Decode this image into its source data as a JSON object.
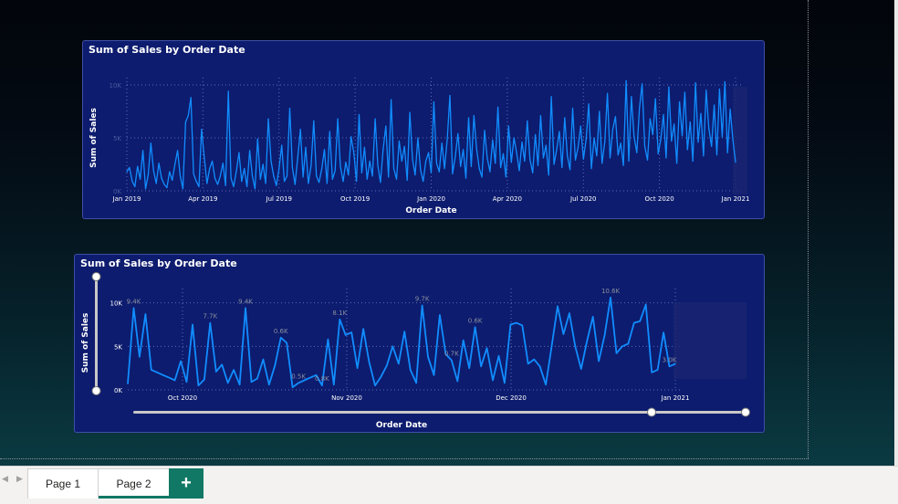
{
  "report": {
    "visual1": {
      "title": "Sum of Sales by Order Date",
      "chart_data": {
        "type": "line",
        "title": "Sum of Sales by Order Date",
        "xlabel": "Order Date",
        "ylabel": "Sum of Sales",
        "x_ticks": [
          "Jan 2019",
          "Apr 2019",
          "Jul 2019",
          "Oct 2019",
          "Jan 2020",
          "Apr 2020",
          "Jul 2020",
          "Oct 2020",
          "Jan 2021"
        ],
        "y_ticks": [
          "0K",
          "5K",
          "10K"
        ],
        "ylim": [
          0,
          10000
        ],
        "grid": true,
        "series": [
          {
            "values": [
              1800,
              2200,
              900,
              400,
              2300,
              1100,
              3800,
              200,
              1500,
              4500,
              1900,
              700,
              2600,
              1200,
              600,
              300,
              1800,
              1000,
              2500,
              3800,
              1400,
              200,
              6500,
              7100,
              8800,
              1600,
              900,
              400,
              5800,
              3200,
              700,
              2100,
              2800,
              1200,
              600,
              1400,
              2600,
              500,
              9400,
              1200,
              400,
              1800,
              3600,
              900,
              2100,
              400,
              3800,
              1400,
              200,
              4900,
              1100,
              2500,
              700,
              6800,
              2800,
              1400,
              500,
              2100,
              4300,
              900,
              1400,
              7800,
              2200,
              600,
              3100,
              5800,
              1300,
              4100,
              700,
              2400,
              6600,
              1400,
              800,
              2100,
              3900,
              700,
              5600,
              1100,
              1900,
              6800,
              2300,
              900,
              2700,
              1500,
              5100,
              3600,
              900,
              7200,
              1700,
              4100,
              1100,
              2800,
              1400,
              6800,
              2400,
              800,
              3900,
              6100,
              1300,
              8600,
              2100,
              1100,
              4700,
              2800,
              4200,
              1000,
              7400,
              3000,
              1500,
              5000,
              2000,
              900,
              2800,
              3600,
              1700,
              8400,
              2600,
              1800,
              4500,
              2100,
              4900,
              9000,
              1600,
              3200,
              5400,
              2300,
              3900,
              1200,
              6900,
              2300,
              7100,
              4000,
              2100,
              1300,
              5700,
              3100,
              1800,
              4800,
              2600,
              7900,
              2200,
              3500,
              1300,
              6100,
              2700,
              5000,
              3600,
              1900,
              4600,
              2800,
              6600,
              3000,
              1700,
              5300,
              2400,
              7100,
              3100,
              4300,
              1500,
              8900,
              2500,
              3900,
              5600,
              2200,
              6900,
              3300,
              2000,
              7800,
              2900,
              4100,
              6100,
              3000,
              4800,
              8200,
              2100,
              5000,
              3300,
              7500,
              2600,
              4600,
              9200,
              3100,
              5800,
              7000,
              3400,
              4500,
              2400,
              10400,
              2800,
              8900,
              5100,
              3600,
              7800,
              10100,
              4200,
              2900,
              6800,
              5300,
              8700,
              3500,
              4900,
              7200,
              3100,
              9800,
              4700,
              6300,
              2600,
              8400,
              5200,
              9300,
              3900,
              6500,
              2800,
              10200,
              4600,
              7300,
              3300,
              9500,
              5900,
              4200,
              8100,
              3400,
              9600,
              5100,
              10300,
              3600,
              7700,
              4800,
              2700
            ]
          }
        ]
      }
    },
    "visual2": {
      "title": "Sum of Sales by Order Date",
      "chart_data": {
        "type": "line",
        "title": "Sum of Sales by Order Date",
        "xlabel": "Order Date",
        "ylabel": "Sum of Sales",
        "x_ticks": [
          "Oct 2020",
          "Nov 2020",
          "Dec 2020",
          "Jan 2021"
        ],
        "y_ticks": [
          "0K",
          "5K",
          "10K"
        ],
        "ylim": [
          0,
          10800
        ],
        "grid": true,
        "series": [
          {
            "values": [
              700,
              9400,
              3800,
              8700,
              2300,
              2000,
              1700,
              1400,
              1100,
              3300,
              900,
              7500,
              500,
              1200,
              7700,
              2100,
              2900,
              800,
              2300,
              600,
              9400,
              900,
              1300,
              3500,
              600,
              2800,
              6000,
              5400,
              300,
              800,
              1100,
              1400,
              1700,
              500,
              5800,
              600,
              8100,
              6300,
              6600,
              2500,
              7000,
              3200,
              500,
              1500,
              2800,
              5000,
              3000,
              6700,
              2300,
              800,
              9700,
              3800,
              1700,
              8600,
              4100,
              3400,
              1000,
              5700,
              2500,
              7200,
              2700,
              4800,
              1100,
              3900,
              800,
              7500,
              7700,
              7400,
              3000,
              3500,
              2700,
              600,
              5000,
              9600,
              6400,
              8800,
              5000,
              2400,
              5600,
              8400,
              3300,
              6300,
              10600,
              4200,
              5000,
              5300,
              7700,
              7900,
              9800,
              2000,
              2300,
              6600,
              2700,
              3000
            ]
          }
        ],
        "data_labels": [
          "9.4K",
          "7.7K",
          "9.4K",
          "0.6K",
          "0.5K",
          "0.8K",
          "8.1K",
          "9.7K",
          "0.7K",
          "0.6K",
          "10.6K",
          "3.0K"
        ]
      }
    },
    "slider": {
      "start": 0.0,
      "end": 0.0
    }
  },
  "tabs": {
    "items": [
      "Page 1",
      "Page 2"
    ],
    "active": "Page 2",
    "add_label": "+"
  },
  "colors": {
    "line": "#118dff",
    "visual_bg": "#0d1c6e",
    "accent": "#117865"
  }
}
